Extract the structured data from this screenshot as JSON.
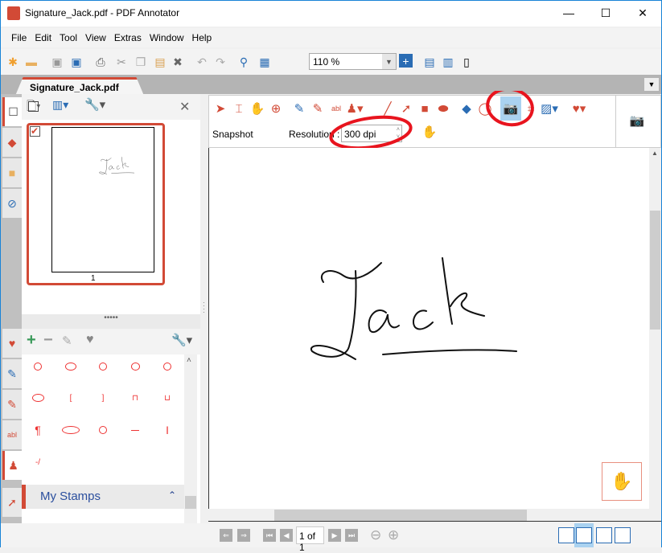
{
  "window": {
    "title": "Signature_Jack.pdf - PDF Annotator",
    "minimize": "—",
    "maximize": "☐",
    "close": "✕"
  },
  "menu": [
    "File",
    "Edit",
    "Tool",
    "View",
    "Extras",
    "Window",
    "Help"
  ],
  "toolbar": {
    "zoom_value": "110 %"
  },
  "tabs": [
    {
      "label": "Signature_Jack.pdf",
      "close": "✕"
    }
  ],
  "thumbnails": {
    "pages": [
      {
        "number": "1",
        "checked": true
      }
    ]
  },
  "stamps": {
    "section_label": "My Stamps"
  },
  "annotation_toolbar": {
    "active_tool": "Snapshot",
    "mode_label": "Snapshot",
    "resolution_label": "Resolution :",
    "resolution_value": "300 dpi"
  },
  "document": {
    "signature_text": "Jack"
  },
  "status": {
    "page_indicator": "1 of 1"
  },
  "colors": {
    "accent": "#d24a36",
    "highlight": "#aad2f0",
    "annotation_circle": "#e8141e"
  }
}
